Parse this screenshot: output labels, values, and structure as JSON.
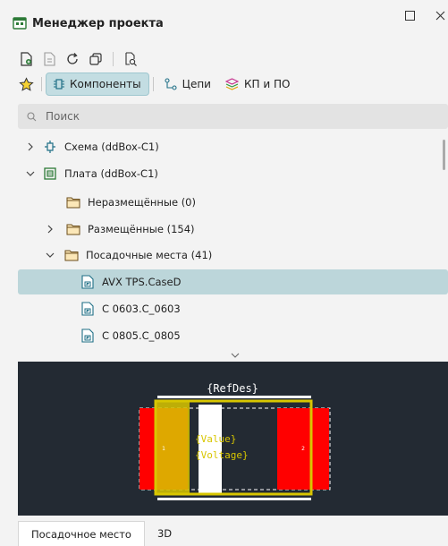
{
  "window": {
    "title": "Менеджер проекта",
    "controls": [
      "restore-icon",
      "close-icon"
    ]
  },
  "toolbar1": {
    "icons": [
      "new-document-icon",
      "import-icon",
      "refresh-icon",
      "copy-window-icon",
      "find-component-icon"
    ]
  },
  "toolbar2": {
    "favorites_icon": "star-icon",
    "tabs": [
      {
        "label": "Компоненты",
        "icon": "components-icon",
        "active": true
      },
      {
        "label": "Цепи",
        "icon": "nets-icon",
        "active": false
      },
      {
        "label": "КП и ПО",
        "icon": "layers-icon",
        "active": false
      }
    ]
  },
  "search": {
    "placeholder": "Поиск"
  },
  "tree": {
    "items": [
      {
        "label": "Схема (ddBox-C1)",
        "icon": "schematic-icon",
        "expanded": false
      },
      {
        "label": "Плата (ddBox-C1)",
        "icon": "board-icon",
        "expanded": true
      },
      {
        "label": "Неразмещённые (0)",
        "icon": "folder-icon"
      },
      {
        "label": "Размещённые (154)",
        "icon": "folder-icon",
        "expanded": false
      },
      {
        "label": "Посадочные места (41)",
        "icon": "folder-icon",
        "expanded": true
      },
      {
        "label": "AVX TPS.CaseD",
        "icon": "footprint-file-icon",
        "selected": true
      },
      {
        "label": "C 0603.C_0603",
        "icon": "footprint-file-icon"
      },
      {
        "label": "C 0805.C_0805",
        "icon": "footprint-file-icon"
      }
    ]
  },
  "preview": {
    "refdes": "{RefDes}",
    "value": "{Value}",
    "voltage": "{Voltage}",
    "pad1": "1",
    "pad2": "2",
    "colors": {
      "background": "#232a33",
      "pad": "#ff0000",
      "silk": "#ffffff",
      "outline": "#d8c600",
      "text": "#d8c600"
    }
  },
  "bottom_tabs": [
    {
      "label": "Посадочное место",
      "active": true
    },
    {
      "label": "3D",
      "active": false
    }
  ]
}
